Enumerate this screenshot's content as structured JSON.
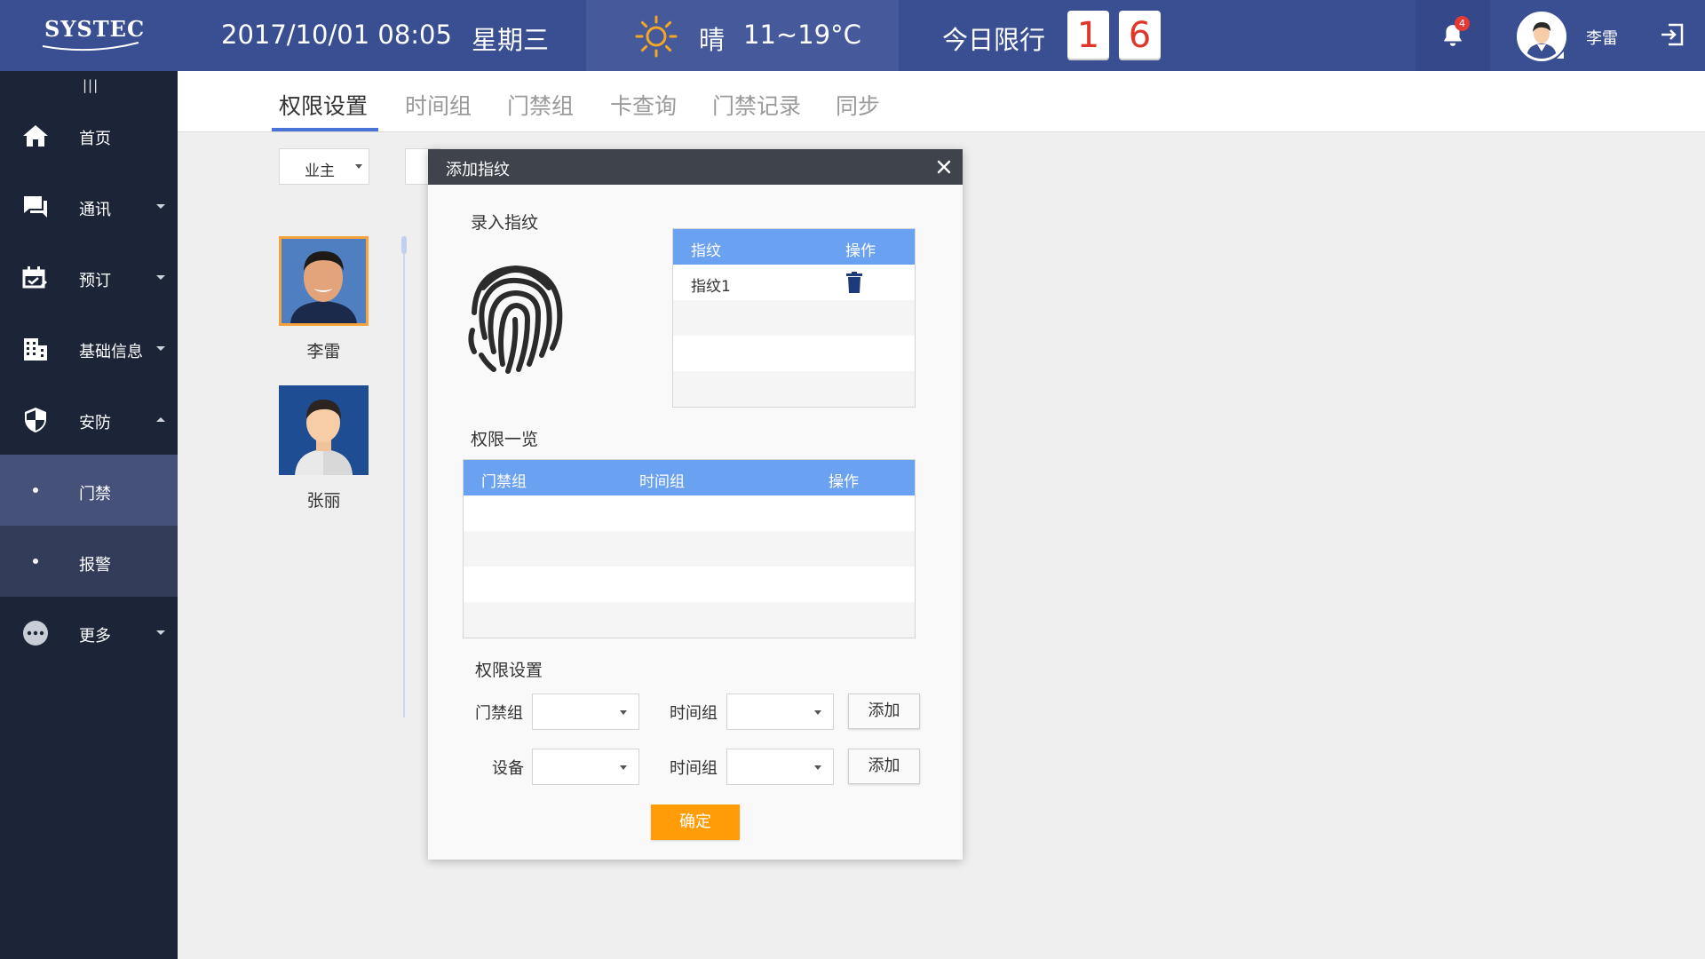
{
  "header": {
    "logo_text": "SYSTEC",
    "datetime": "2017/10/01  08:05",
    "weekday": "星期三",
    "weather": {
      "condition": "晴",
      "temperature": "11~19°C",
      "icon": "sun-icon"
    },
    "plate_limit": {
      "label": "今日限行",
      "digits": [
        "1",
        "6"
      ]
    },
    "notification_count": "4",
    "user_name": "李雷"
  },
  "sidebar": {
    "menu_icon": "|||",
    "items": [
      {
        "label": "首页",
        "icon": "home-icon"
      },
      {
        "label": "通讯",
        "icon": "chat-icon"
      },
      {
        "label": "预订",
        "icon": "booking-icon"
      },
      {
        "label": "基础信息",
        "icon": "building-icon"
      },
      {
        "label": "安防",
        "icon": "shield-icon"
      },
      {
        "label": "更多",
        "icon": "more-icon"
      }
    ],
    "subitems": [
      {
        "label": "门禁",
        "active": true
      },
      {
        "label": "报警",
        "active": false
      }
    ]
  },
  "tabs": [
    "权限设置",
    "时间组",
    "门禁组",
    "卡查询",
    "门禁记录",
    "同步"
  ],
  "filter": {
    "selected": "业主"
  },
  "people": [
    {
      "name": "李雷"
    },
    {
      "name": "张丽"
    }
  ],
  "modal": {
    "title": "添加指纹",
    "enroll_label": "录入指纹",
    "fingerprint_table": {
      "headers": [
        "指纹",
        "操作"
      ],
      "rows": [
        {
          "name": "指纹1"
        }
      ]
    },
    "permission_overview_label": "权限一览",
    "permission_table": {
      "headers": [
        "门禁组",
        "时间组",
        "操作"
      ]
    },
    "permission_settings_label": "权限设置",
    "form": {
      "row1": {
        "label1": "门禁组",
        "label2": "时间组",
        "button": "添加"
      },
      "row2": {
        "label1": "设备",
        "label2": "时间组",
        "button": "添加"
      }
    },
    "confirm": "确定"
  },
  "colors": {
    "topbar": "#3a4f92",
    "sidebar": "#1c2438",
    "table_header": "#6aa1f0",
    "confirm": "#ff9c07",
    "tab_underline": "#4a73d8"
  }
}
